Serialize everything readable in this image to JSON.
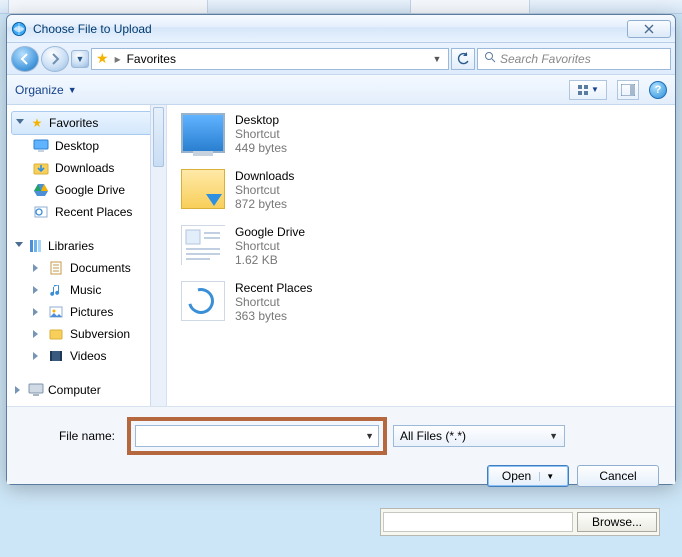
{
  "titlebar": {
    "title": "Choose File to Upload"
  },
  "nav": {
    "location": "Favorites",
    "search_placeholder": "Search Favorites"
  },
  "toolbar": {
    "organize": "Organize"
  },
  "sidebar": {
    "favorites": {
      "label": "Favorites",
      "items": [
        {
          "label": "Desktop"
        },
        {
          "label": "Downloads"
        },
        {
          "label": "Google Drive"
        },
        {
          "label": "Recent Places"
        }
      ]
    },
    "libraries": {
      "label": "Libraries",
      "items": [
        {
          "label": "Documents"
        },
        {
          "label": "Music"
        },
        {
          "label": "Pictures"
        },
        {
          "label": "Subversion"
        },
        {
          "label": "Videos"
        }
      ]
    },
    "computer": {
      "label": "Computer"
    }
  },
  "files": [
    {
      "name": "Desktop",
      "sub1": "Shortcut",
      "sub2": "449 bytes"
    },
    {
      "name": "Downloads",
      "sub1": "Shortcut",
      "sub2": "872 bytes"
    },
    {
      "name": "Google Drive",
      "sub1": "Shortcut",
      "sub2": "1.62 KB"
    },
    {
      "name": "Recent Places",
      "sub1": "Shortcut",
      "sub2": "363 bytes"
    }
  ],
  "bottom": {
    "filename_label": "File name:",
    "filename_value": "",
    "filter": "All Files (*.*)",
    "open": "Open",
    "cancel": "Cancel"
  },
  "host": {
    "browse": "Browse..."
  }
}
